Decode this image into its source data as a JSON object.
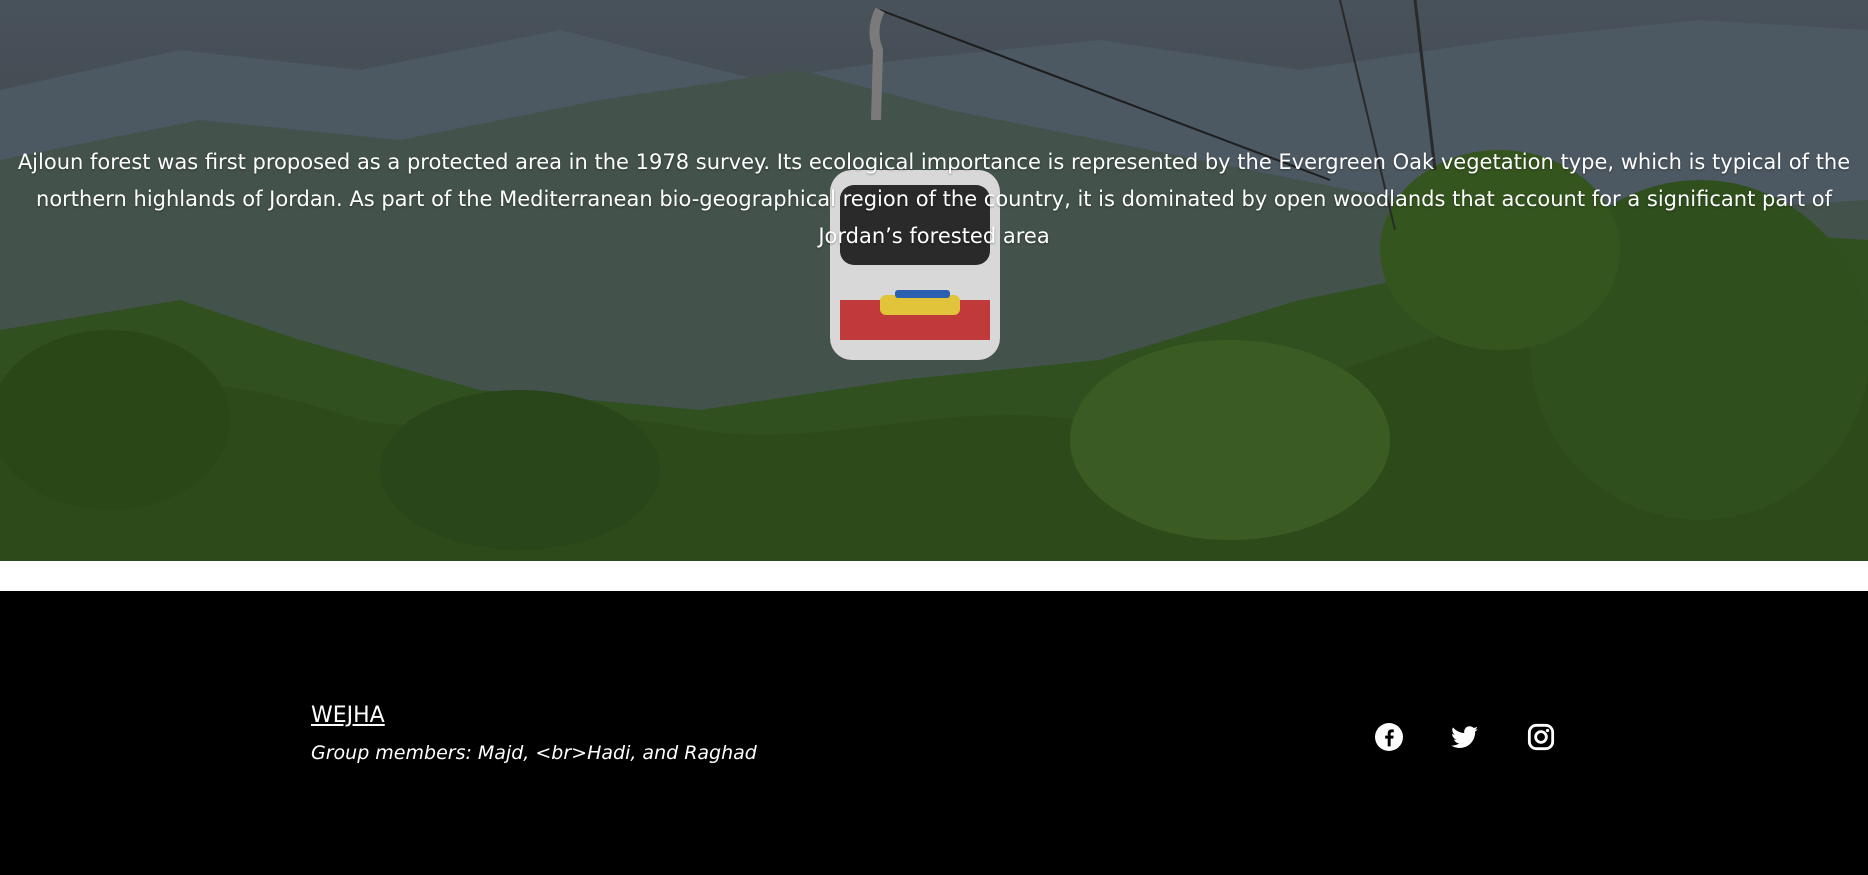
{
  "hero": {
    "description": "Ajloun forest was first proposed as a protected area in the 1978 survey. Its ecological importance is represented by the Evergreen Oak vegetation type, which is typical of the northern highlands of Jordan. As part of the Mediterranean bio-geographical region of the country, it is dominated by open woodlands that account for a significant part of Jordan’s forested area"
  },
  "footer": {
    "brand": "WEJHA",
    "members": "Group members: Majd, <br>Hadi, and Raghad",
    "social": [
      {
        "icon": "facebook-icon"
      },
      {
        "icon": "twitter-icon"
      },
      {
        "icon": "instagram-icon"
      }
    ]
  },
  "colors": {
    "footer_bg": "#000000",
    "text": "#ffffff"
  }
}
